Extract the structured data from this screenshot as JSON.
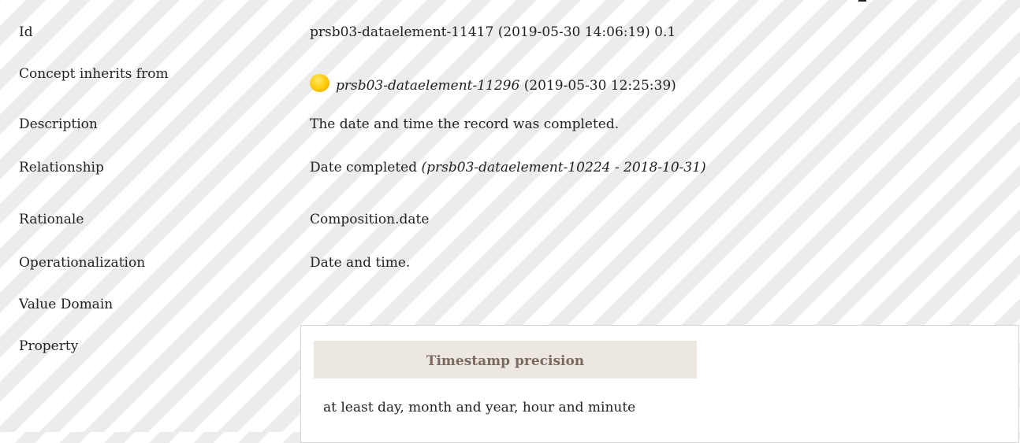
{
  "rows": [
    {
      "label": "Id",
      "value": "prsb03-dataelement-11417 (2019-05-30 14:06:19) 0.1"
    },
    {
      "label": "Concept inherits from",
      "value_link": "prsb03-dataelement-11296",
      "value_suffix": " (2019-05-30 12:25:39)"
    },
    {
      "label": "Description",
      "value": "The date and time the record was completed."
    },
    {
      "label": "Relationship",
      "value": "Date completed ",
      "value_italic": "(prsb03-dataelement-10224 - 2018-10-31)"
    },
    {
      "label": "Rationale",
      "value": "Composition.date"
    },
    {
      "label": "Operationalization",
      "value": "Date and time."
    },
    {
      "label": "Value Domain",
      "value": ""
    },
    {
      "label": "Property",
      "value": ""
    }
  ],
  "property_panel": {
    "header": "Timestamp precision",
    "value": "at least day, month and year, hour and minute"
  },
  "colors": {
    "stripe_light": "#ffffff",
    "stripe_dark": "#ececec",
    "panel_header_bg": "#ece7e1",
    "panel_header_text": "#7a6a60",
    "status_dot": "#ffc800"
  },
  "icons": {
    "status": "yellow-status-dot-icon"
  }
}
